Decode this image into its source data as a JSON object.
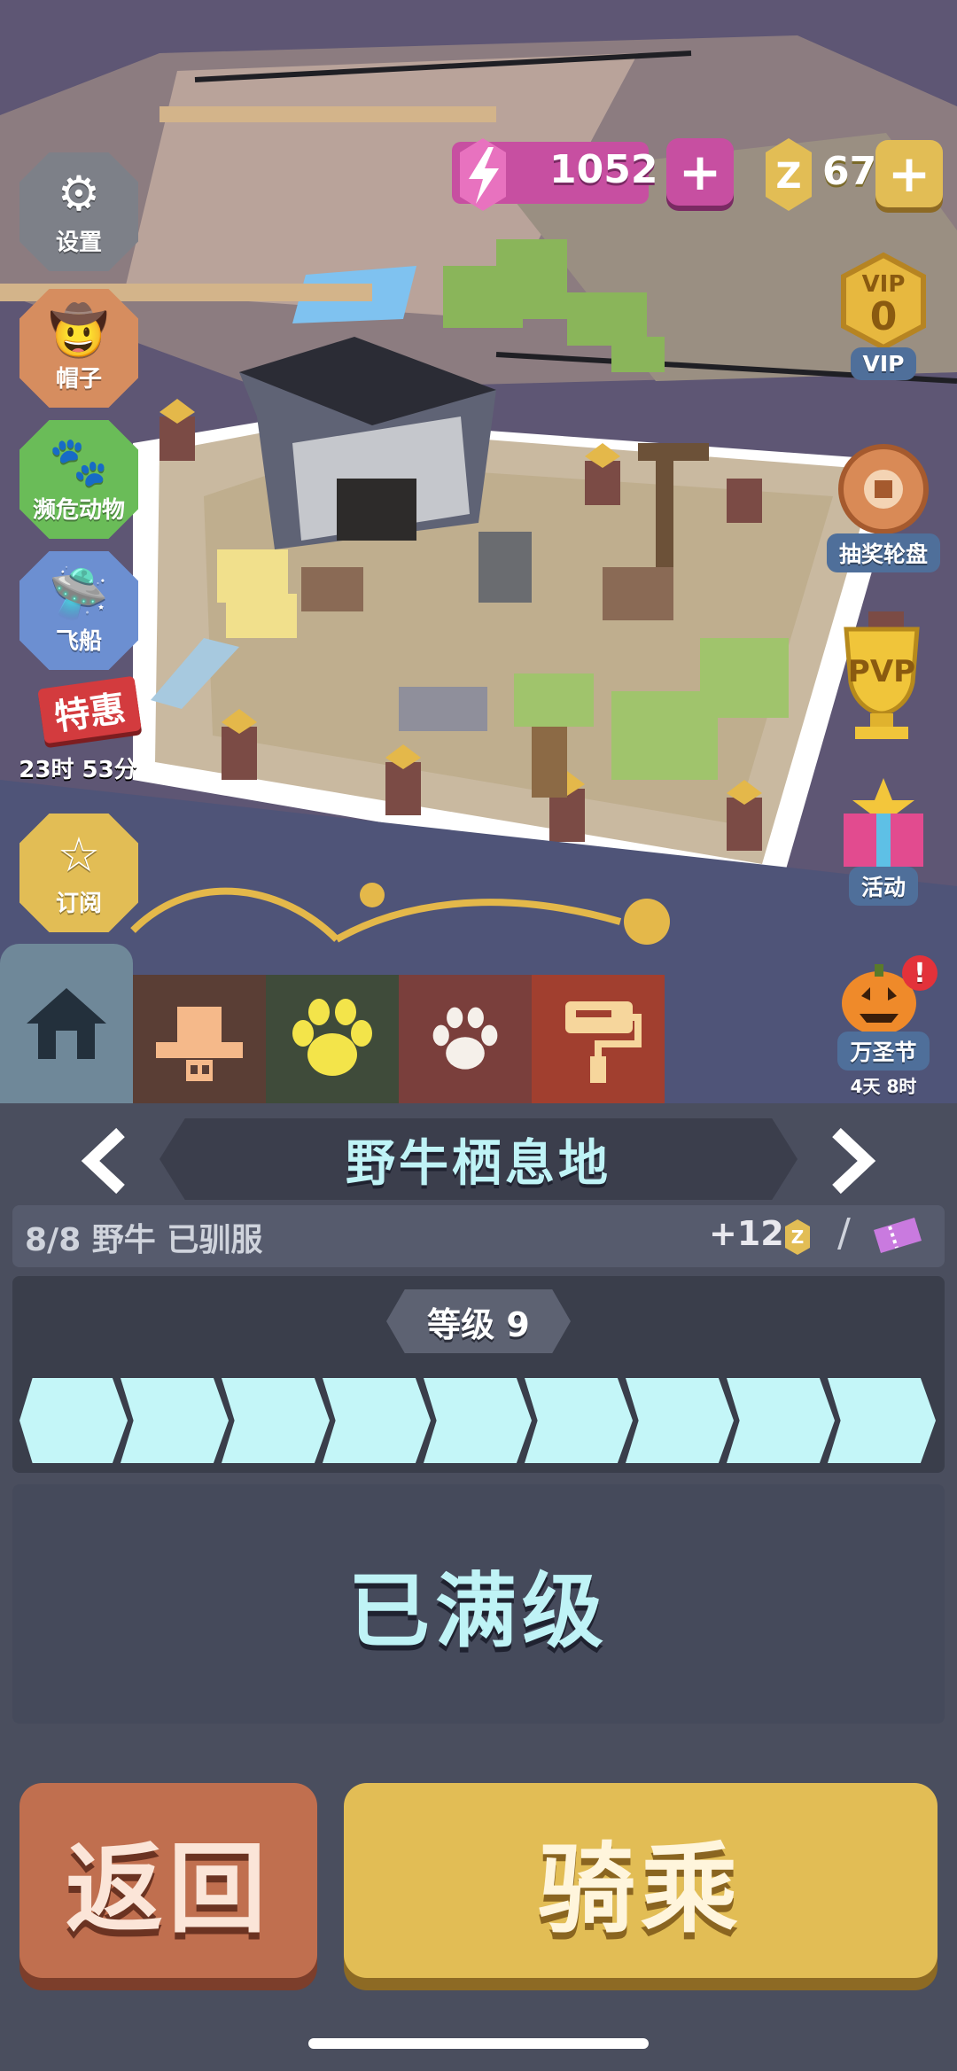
{
  "hud": {
    "energy": "1052",
    "coins": "67"
  },
  "left_menu": [
    {
      "label": "设置",
      "icon": "gear-icon"
    },
    {
      "label": "帽子",
      "icon": "hat-icon"
    },
    {
      "label": "濒危动物",
      "icon": "paw-icon"
    },
    {
      "label": "飞船",
      "icon": "spaceship-icon"
    },
    {
      "label": "订阅",
      "icon": "star-icon"
    }
  ],
  "special_offer": {
    "label": "特惠",
    "timer": "23时 53分"
  },
  "right_menu": {
    "vip": {
      "label": "VIP",
      "badge_title": "VIP",
      "level": "0"
    },
    "lottery": {
      "label": "抽奖轮盘"
    },
    "pvp": {
      "label": "PVP"
    },
    "events": {
      "label": "活动"
    },
    "halloween": {
      "label": "万圣节",
      "timer": "4天 8时",
      "alert": "!"
    }
  },
  "tabs": [
    {
      "name": "home",
      "icon": "home-icon",
      "active": true
    },
    {
      "name": "hats",
      "icon": "hat-icon"
    },
    {
      "name": "animals",
      "icon": "paw-icon"
    },
    {
      "name": "endangered",
      "icon": "paw-print-icon"
    },
    {
      "name": "paint",
      "icon": "paint-roller-icon"
    }
  ],
  "habitat": {
    "title": "野牛栖息地",
    "tamed_status": "8/8 野牛 已驯服",
    "reward": "+12",
    "level_label": "等级 9",
    "level_progress": 1.0,
    "level_segments": 9,
    "max_label": "已满级"
  },
  "buttons": {
    "back": "返回",
    "ride": "骑乘"
  },
  "colors": {
    "energy": "#c74fa1",
    "coin": "#e2bd55",
    "back_button": "#c06f4f",
    "ride_button": "#e2bd55",
    "level_segment": "#c4f6f8",
    "title_text": "#bff3f6"
  }
}
